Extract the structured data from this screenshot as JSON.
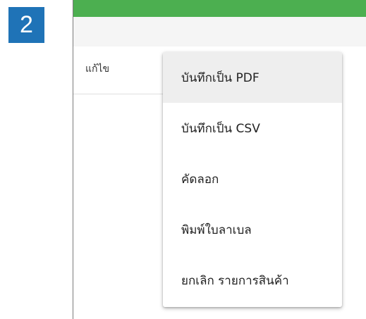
{
  "step": {
    "number": "2"
  },
  "toolbar": {
    "edit_label": "แก้ไข"
  },
  "menu": {
    "items": [
      {
        "label": "บันทึกเป็น PDF",
        "highlighted": true
      },
      {
        "label": "บันทึกเป็น CSV",
        "highlighted": false
      },
      {
        "label": "คัดลอก",
        "highlighted": false
      },
      {
        "label": "พิมพ์ใบลาเบล",
        "highlighted": false
      },
      {
        "label": "ยกเลิก รายการสินค้า",
        "highlighted": false
      }
    ]
  },
  "colors": {
    "step_badge": "#1f73b7",
    "top_bar": "#4caf50",
    "menu_highlight": "#eeeeee"
  }
}
